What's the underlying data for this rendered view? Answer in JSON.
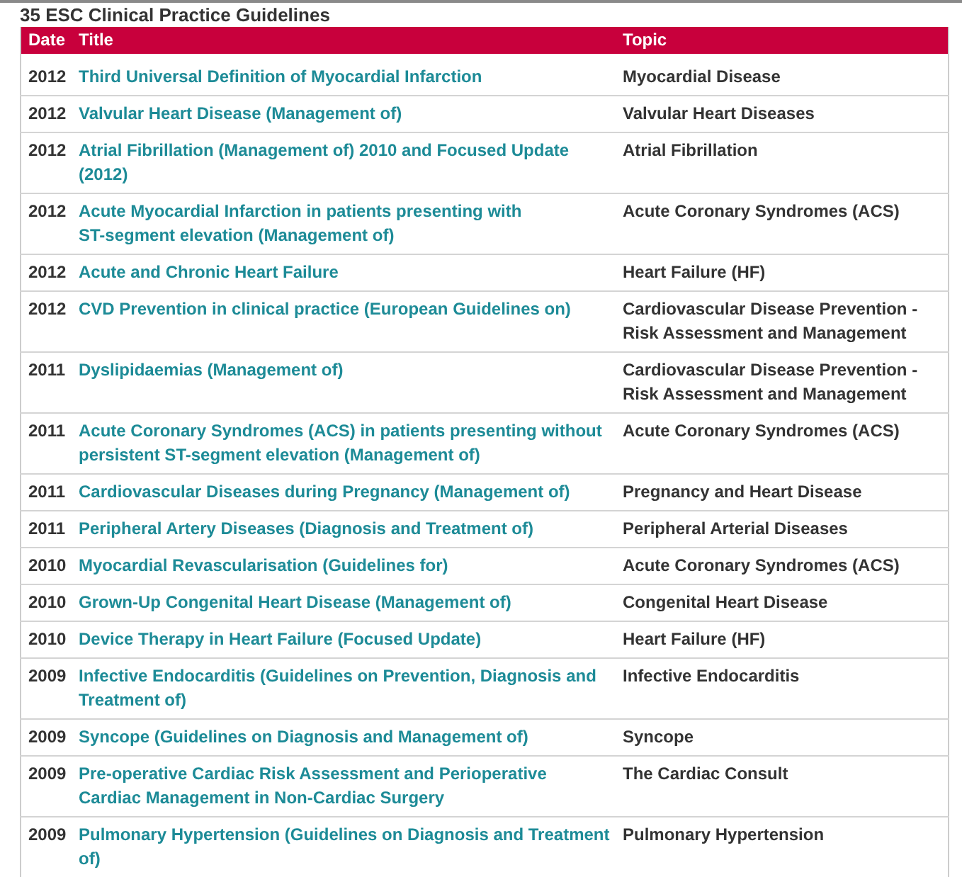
{
  "heading": "35 ESC Clinical Practice Guidelines",
  "table": {
    "columns": [
      "Date",
      "Title",
      "Topic"
    ],
    "rows": [
      {
        "date": "2012",
        "title": [
          "Third Universal Definition of Myocardial Infarction"
        ],
        "topic": "Myocardial Disease"
      },
      {
        "date": "2012",
        "title": [
          "Valvular Heart Disease (Management of)"
        ],
        "topic": "Valvular Heart Diseases"
      },
      {
        "date": "2012",
        "title": [
          "Atrial Fibrillation (Management of) 2010 and Focused Update",
          "(2012)"
        ],
        "topic": "Atrial Fibrillation"
      },
      {
        "date": "2012",
        "title": [
          "Acute Myocardial Infarction in patients presenting with",
          "ST-segment elevation (Management of)"
        ],
        "topic": "Acute Coronary Syndromes (ACS)"
      },
      {
        "date": "2012",
        "title": [
          "Acute and Chronic Heart Failure"
        ],
        "topic": "Heart Failure (HF)"
      },
      {
        "date": "2012",
        "title": [
          "CVD Prevention in clinical practice (European Guidelines on)"
        ],
        "topic": "Cardiovascular Disease Prevention - Risk Assessment and Management"
      },
      {
        "date": "2011",
        "title": [
          "Dyslipidaemias (Management of)"
        ],
        "topic": "Cardiovascular Disease Prevention - Risk Assessment and Management"
      },
      {
        "date": "2011",
        "title": [
          "Acute Coronary Syndromes (ACS) in patients presenting without",
          "persistent ST-segment elevation (Management of)"
        ],
        "topic": "Acute Coronary Syndromes (ACS)"
      },
      {
        "date": "2011",
        "title": [
          "Cardiovascular Diseases during Pregnancy (Management of)"
        ],
        "topic": "Pregnancy and Heart Disease"
      },
      {
        "date": "2011",
        "title": [
          "Peripheral Artery Diseases (Diagnosis and Treatment of)"
        ],
        "topic": "Peripheral Arterial Diseases"
      },
      {
        "date": "2010",
        "title": [
          "Myocardial Revascularisation (Guidelines for)"
        ],
        "topic": "Acute Coronary Syndromes (ACS)"
      },
      {
        "date": "2010",
        "title": [
          "Grown-Up Congenital Heart Disease (Management of)"
        ],
        "topic": "Congenital Heart Disease"
      },
      {
        "date": "2010",
        "title": [
          "Device Therapy in Heart Failure (Focused Update)"
        ],
        "topic": "Heart Failure (HF)"
      },
      {
        "date": "2009",
        "title": [
          "Infective Endocarditis (Guidelines on Prevention, Diagnosis and",
          "Treatment of)"
        ],
        "topic": "Infective Endocarditis"
      },
      {
        "date": "2009",
        "title": [
          "Syncope (Guidelines on Diagnosis and Management of)"
        ],
        "topic": "Syncope"
      },
      {
        "date": "2009",
        "title": [
          "Pre-operative Cardiac Risk Assessment and Perioperative",
          "Cardiac Management in Non-Cardiac Surgery"
        ],
        "topic": "The Cardiac Consult"
      },
      {
        "date": "2009",
        "title": [
          "Pulmonary Hypertension (Guidelines on Diagnosis and Treatment",
          "of)"
        ],
        "topic": "Pulmonary Hypertension"
      }
    ]
  }
}
